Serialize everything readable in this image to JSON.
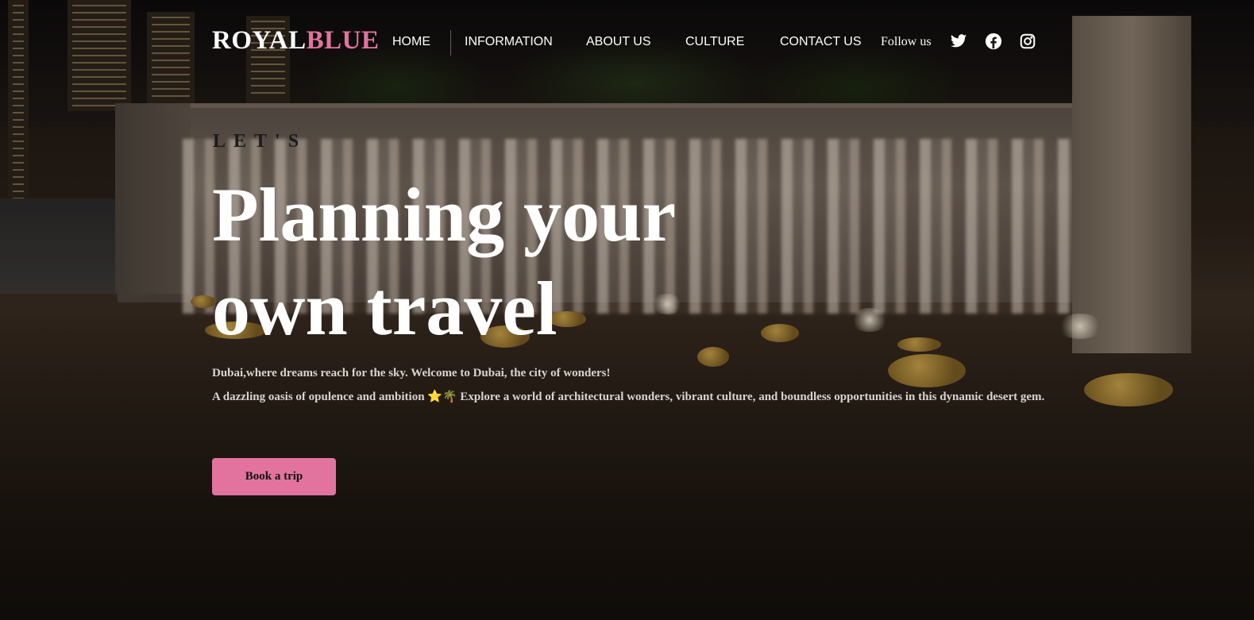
{
  "brand": {
    "part1": "ROYAL",
    "part2": "BLUE"
  },
  "nav": {
    "home": "HOME",
    "information": "INFORMATION",
    "about": "ABOUT US",
    "culture": "CULTURE",
    "contact": "CONTACT US"
  },
  "social": {
    "follow_label": "Follow us",
    "icons": [
      "twitter-icon",
      "facebook-icon",
      "instagram-icon"
    ]
  },
  "hero": {
    "eyebrow": "LET'S",
    "headline": "Planning your own travel",
    "line1": "Dubai,where dreams reach for the sky. Welcome to Dubai, the city of wonders!",
    "line2": "A dazzling oasis of opulence and ambition ⭐🌴 Explore a world of architectural wonders, vibrant culture, and boundless opportunities in this dynamic desert gem.",
    "cta": "Book a trip"
  },
  "colors": {
    "accent": "#e2739f",
    "text": "#ffffff",
    "body_text": "#d9d4cf"
  }
}
